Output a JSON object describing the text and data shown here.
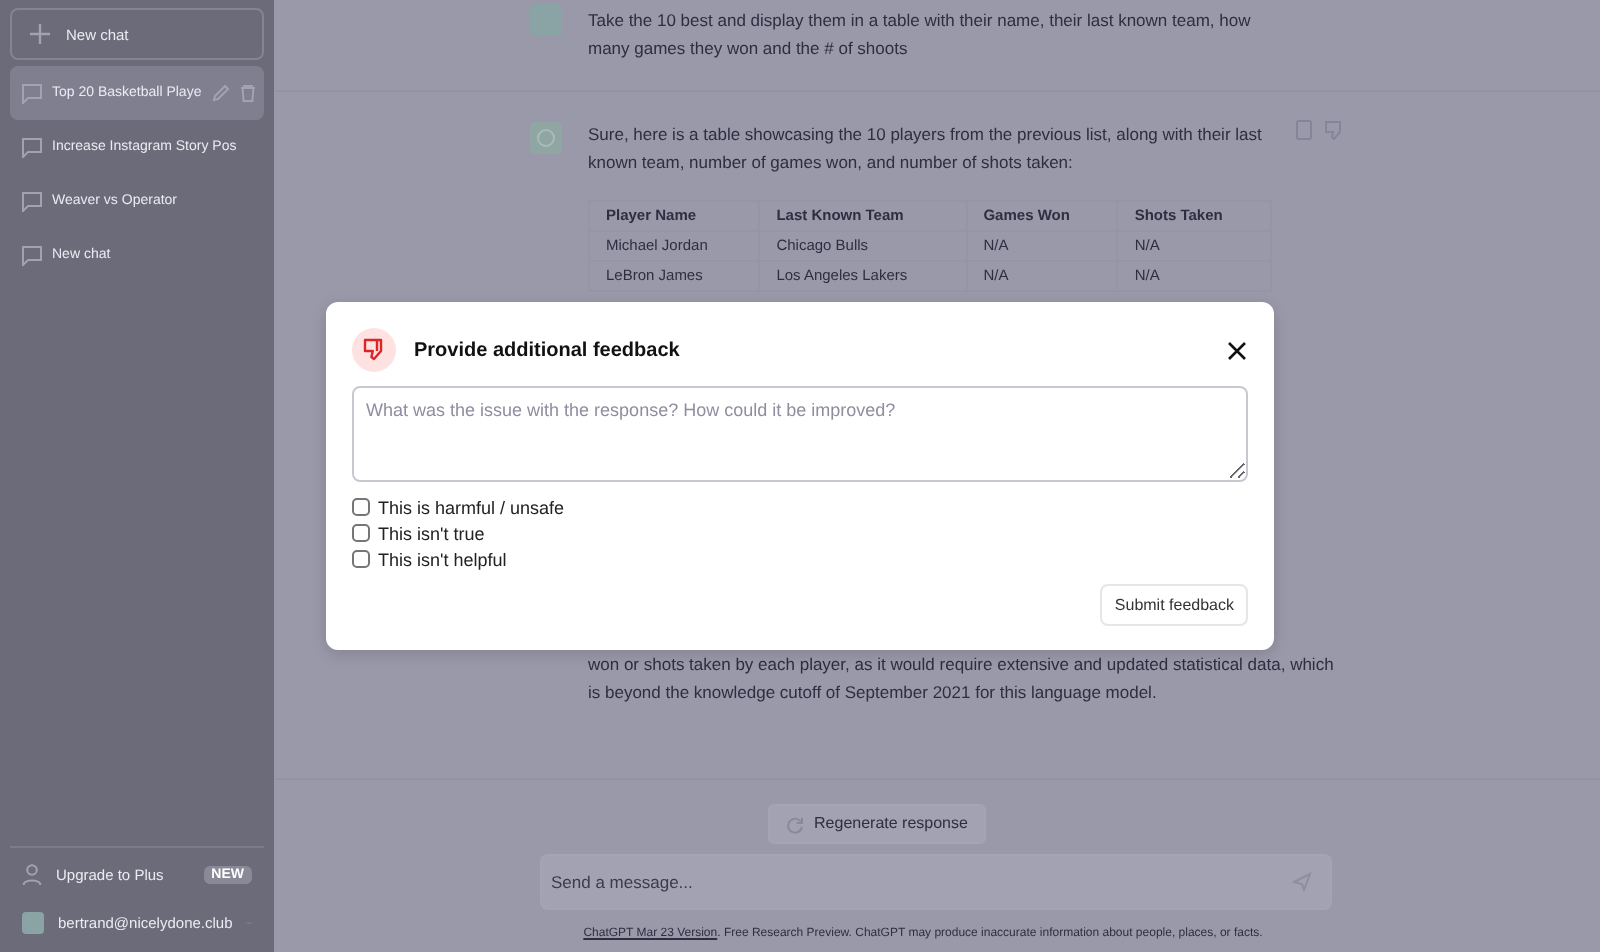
{
  "sidebar": {
    "new_chat": "New chat",
    "items": [
      {
        "title": "Top 20 Basketball Playe",
        "selected": true
      },
      {
        "title": "Increase Instagram Story Pos",
        "selected": false
      },
      {
        "title": "Weaver vs Operator",
        "selected": false
      },
      {
        "title": "New chat",
        "selected": false
      }
    ],
    "upgrade": {
      "label": "Upgrade to Plus",
      "badge": "NEW"
    },
    "user": {
      "email": "bertrand@nicelydone.club"
    }
  },
  "conversation": {
    "user_message": "Take the 10 best and display them in a table with their name, their last known team, how many games they won and the # of shoots",
    "assistant_intro": "Sure, here is a table showcasing the 10 players from the previous list, along with their last known team, number of games won, and number of shots taken:",
    "table": {
      "columns": [
        "Player Name",
        "Last Known Team",
        "Games Won",
        "Shots Taken"
      ],
      "rows": [
        [
          "Michael Jordan",
          "Chicago Bulls",
          "N/A",
          "N/A"
        ],
        [
          "LeBron James",
          "Los Angeles Lakers",
          "N/A",
          "N/A"
        ]
      ]
    },
    "assistant_outro": "won or shots taken by each player, as it would require extensive and updated statistical data, which is beyond the knowledge cutoff of September 2021 for this language model."
  },
  "regenerate": "Regenerate response",
  "composer": {
    "placeholder": "Send a message..."
  },
  "footer": {
    "link": "ChatGPT Mar 23 Version",
    "text": ". Free Research Preview. ChatGPT may produce inaccurate information about people, places, or facts."
  },
  "dialog": {
    "title": "Provide additional feedback",
    "placeholder": "What was the issue with the response? How could it be improved?",
    "options": [
      {
        "label": "This is harmful / unsafe",
        "checked": false
      },
      {
        "label": "This isn't true",
        "checked": false
      },
      {
        "label": "This isn't helpful",
        "checked": false
      }
    ],
    "submit": "Submit feedback"
  }
}
